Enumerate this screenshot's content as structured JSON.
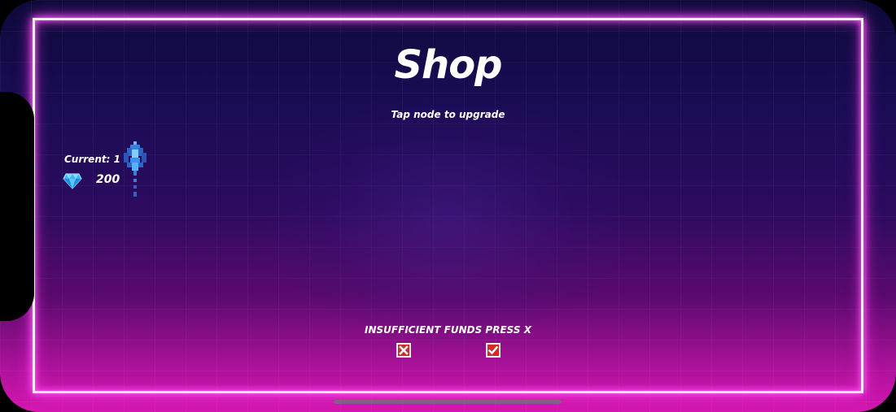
{
  "shop": {
    "title": "Shop",
    "subtitle": "Tap node to upgrade"
  },
  "player": {
    "current_label": "Current: 1",
    "gems": "200",
    "gem_icon": "diamond-icon",
    "ship_icon": "spaceship-icon"
  },
  "dialog": {
    "message": "INSUFFICIENT FUNDS PRESS X",
    "cancel_icon": "close-icon",
    "confirm_icon": "checkmark-icon"
  },
  "colors": {
    "frame_neon": "#ff66ff",
    "cancel_red": "#d22b2b",
    "confirm_red": "#d22b2b",
    "gem_blue": "#3fb6ff"
  }
}
